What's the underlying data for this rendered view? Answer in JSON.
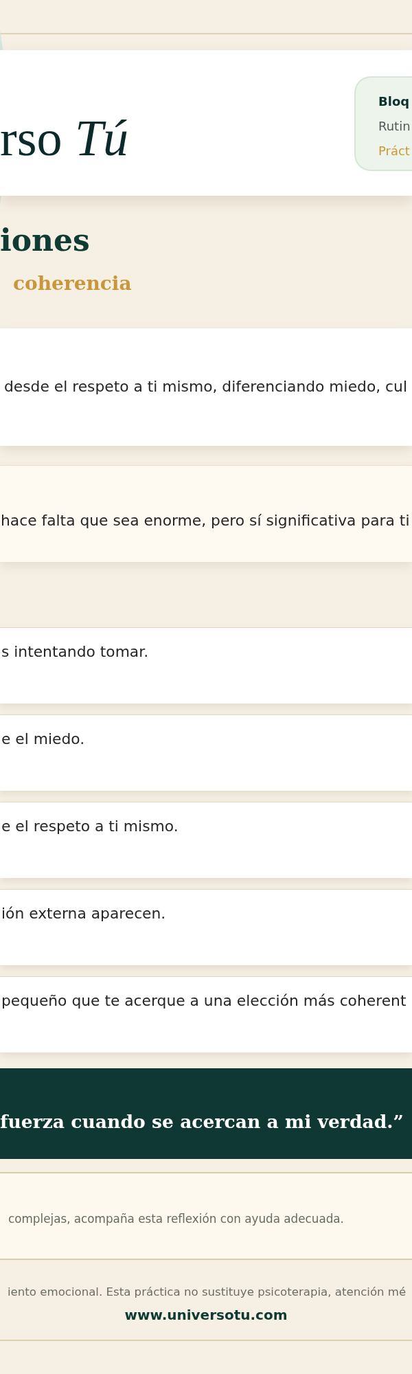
{
  "header": {
    "logo": "rso *Tú*",
    "badge": [
      {
        "kind": "heading",
        "text": "Bloq"
      },
      {
        "kind": "subheading",
        "text": "Rutin"
      },
      {
        "kind": "caption",
        "text": "Práct"
      }
    ]
  },
  "title": "iones",
  "subtitle": "coherencia",
  "panels": [
    {
      "kind": "plain",
      "text": "desde el respeto a ti mismo, diferenciando miedo, cul"
    },
    {
      "kind": "highlight",
      "text": "hace falta que sea enorme, pero sí significativa para ti"
    }
  ],
  "steps": [
    "s intentando tomar.",
    "e el miedo.",
    "e el respeto a ti mismo.",
    "ión externa aparecen.",
    "pequeño que te acerque a una elección más coherent"
  ],
  "quote": "fuerza cuando se acercan a mi verdad.”",
  "note": "complejas, acompaña esta reflexión con ayuda adecuada.",
  "footer": {
    "disclaimer": "iento emocional. Esta práctica no sustituye psicoterapia, atención mé",
    "website": "www.universotu.com"
  }
}
